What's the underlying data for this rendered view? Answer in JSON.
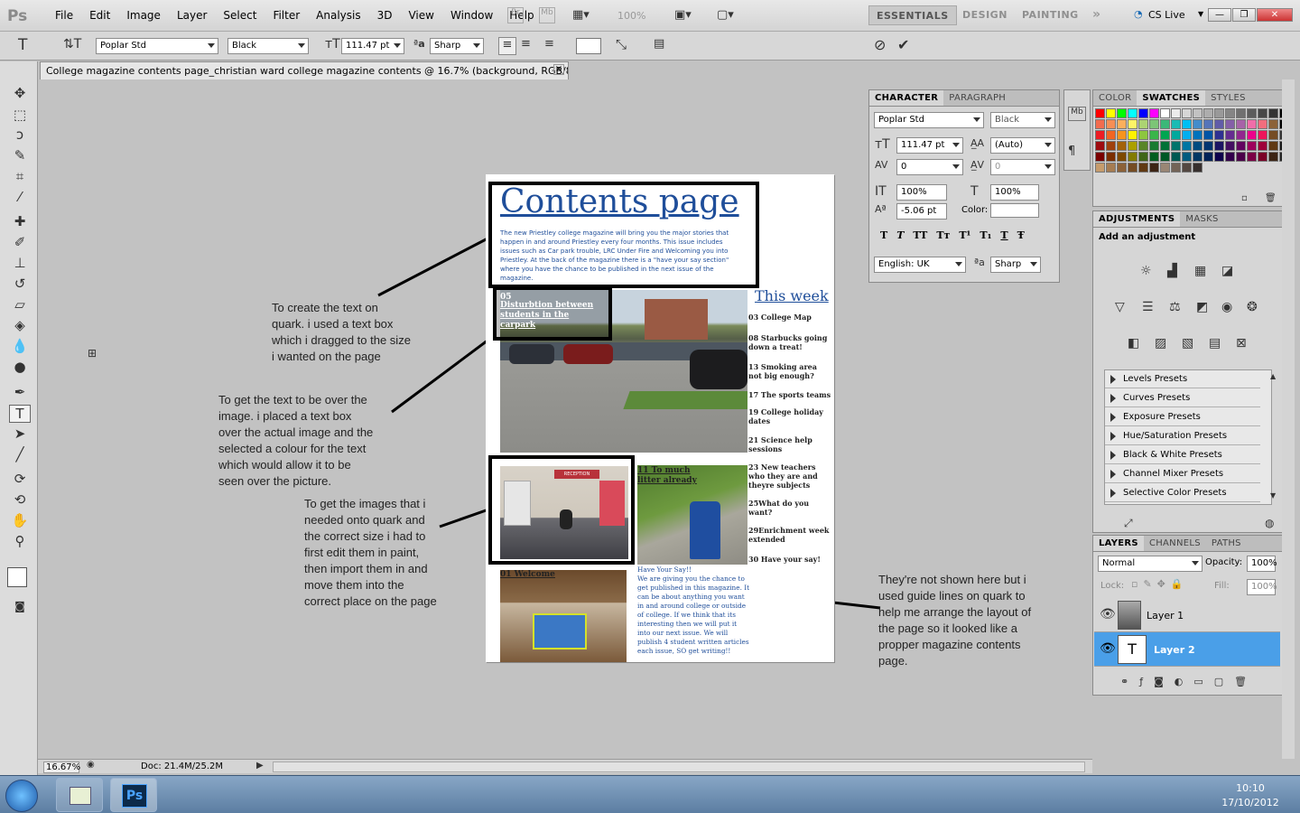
{
  "app": {
    "logo": "Ps",
    "menu": [
      "File",
      "Edit",
      "Image",
      "Layer",
      "Select",
      "Filter",
      "Analysis",
      "3D",
      "View",
      "Window",
      "Help"
    ],
    "zoom_field": "100%",
    "workspaces": [
      "ESSENTIALS",
      "DESIGN",
      "PAINTING"
    ],
    "cs_live": "CS Live"
  },
  "options": {
    "font_family": "Poplar Std",
    "font_style": "Black",
    "font_size": "111.47 pt",
    "aa_label": "aa",
    "antialias": "Sharp"
  },
  "document": {
    "tab_title": "College magazine contents page_christian ward college magazine contents @ 16.7% (background, RGB/8) *",
    "heading": "Contents page",
    "intro": "The new Priestley college magazine will bring you the major stories that happen in and around Priestley every four months. This issue includes issues such as Car park trouble, LRC Under Fire and Welcoming you into Priestley. At the back of the magazine there is a \"have your say section\" where you have the chance to be published in the next issue of the magazine.",
    "overlay_number": "05",
    "overlay_text": "Disturbtion between students in the carpark",
    "this_week": "This week",
    "stories": [
      "03 College Map",
      "08 Starbucks going down a treat!",
      "13 Smoking area not big enough?",
      "17 The sports teams",
      "19 College holiday dates",
      "21 Science help sessions",
      "23 New teachers who they are and theyre subjects",
      "25What do you want?",
      "29Enrichment week extended",
      "30 Have your say!"
    ],
    "litter_text": "11 To much litter already",
    "welcome_text": "01 Welcome",
    "reception_sign": "RECEPTION",
    "have_your_say": "Have Your Say!!\nWe are giving you the chance to get published in this magazine. It can be about anything you want in and around college or outside of college. If we think that its interesting then we will put it into our next issue. We will publish 4 student written articles each issue, SO get writing!!"
  },
  "annotations": [
    "To create the text on\nquark. i used a text box\nwhich i dragged to the size\ni wanted on the page",
    "To get the text to be over the\nimage. i placed a text box\nover the actual image and the\nselected a colour for the text\nwhich would allow it to be\nseen over the picture.",
    "To get the images that i\nneeded onto quark and\nthe correct size i had to\nfirst edit them in paint,\nthen import them in and\nmove them into the\ncorrect place on the page",
    "They're not shown here but i\nused guide lines on quark to\nhelp me arrange the layout of\nthe page so it looked like a\npropper magazine contents\npage."
  ],
  "character_panel": {
    "tabs": [
      "CHARACTER",
      "PARAGRAPH"
    ],
    "font_family": "Poplar Std",
    "font_style": "Black",
    "size": "111.47 pt",
    "leading": "(Auto)",
    "kerning": "0",
    "tracking": "0",
    "vscale": "100%",
    "hscale": "100%",
    "baseline": "-5.06 pt",
    "color_label": "Color:",
    "language": "English: UK",
    "antialias": "Sharp",
    "style_buttons": [
      "T",
      "T",
      "TT",
      "Tт",
      "T¹",
      "T₁",
      "T",
      "Ŧ"
    ]
  },
  "swatches_panel": {
    "tabs": [
      "COLOR",
      "SWATCHES",
      "STYLES"
    ]
  },
  "adjustments_panel": {
    "tabs": [
      "ADJUSTMENTS",
      "MASKS"
    ],
    "title": "Add an adjustment",
    "presets": [
      "Levels Presets",
      "Curves Presets",
      "Exposure Presets",
      "Hue/Saturation Presets",
      "Black & White Presets",
      "Channel Mixer Presets",
      "Selective Color Presets"
    ]
  },
  "layers_panel": {
    "tabs": [
      "LAYERS",
      "CHANNELS",
      "PATHS"
    ],
    "blend_mode": "Normal",
    "opacity_label": "Opacity:",
    "opacity": "100%",
    "lock_label": "Lock:",
    "fill_label": "Fill:",
    "fill": "100%",
    "layers": [
      "Layer 1",
      "Layer 2"
    ],
    "selected_layer": "Layer 2"
  },
  "status": {
    "zoom": "16.67%",
    "doc": "Doc: 21.4M/25.2M"
  },
  "taskbar": {
    "time": "10:10",
    "date": "17/10/2012",
    "ps_label": "Ps"
  },
  "colors": {
    "accent": "#3b8fe6",
    "heading_blue": "#1f4e9a",
    "selected_layer": "#4a9fe8"
  }
}
